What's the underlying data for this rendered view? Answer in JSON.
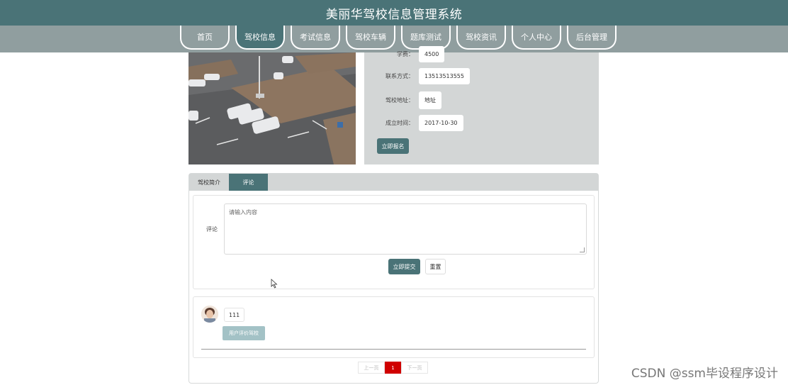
{
  "header": {
    "title": "美丽华驾校信息管理系统"
  },
  "nav": {
    "items": [
      {
        "label": "首页",
        "active": false
      },
      {
        "label": "驾校信息",
        "active": true
      },
      {
        "label": "考试信息",
        "active": false
      },
      {
        "label": "驾校车辆",
        "active": false
      },
      {
        "label": "题库测试",
        "active": false
      },
      {
        "label": "驾校资讯",
        "active": false
      },
      {
        "label": "个人中心",
        "active": false
      },
      {
        "label": "后台管理",
        "active": false
      }
    ]
  },
  "info": {
    "rows": [
      {
        "label": "学费：",
        "value": "4500"
      },
      {
        "label": "联系方式：",
        "value": "13513513555"
      },
      {
        "label": "驾校地址：",
        "value": "地址"
      },
      {
        "label": "成立时间：",
        "value": "2017-10-30"
      }
    ],
    "signup_button": "立即报名"
  },
  "tabs": {
    "intro": "驾校简介",
    "comment": "评论"
  },
  "comment_form": {
    "label": "评论",
    "placeholder": "请输入内容",
    "submit": "立即提交",
    "reset": "重置"
  },
  "comments": [
    {
      "content": "111",
      "tag": "用户评价驾校"
    }
  ],
  "pagination": {
    "prev": "上一页",
    "current": "1",
    "next": "下一页"
  },
  "watermark": "CSDN @ssm毕设程序设计",
  "colors": {
    "primary": "#4a7377",
    "nav_bg": "#909e9f",
    "panel_bg": "#d3d6d6",
    "page_active": "#d00000"
  }
}
